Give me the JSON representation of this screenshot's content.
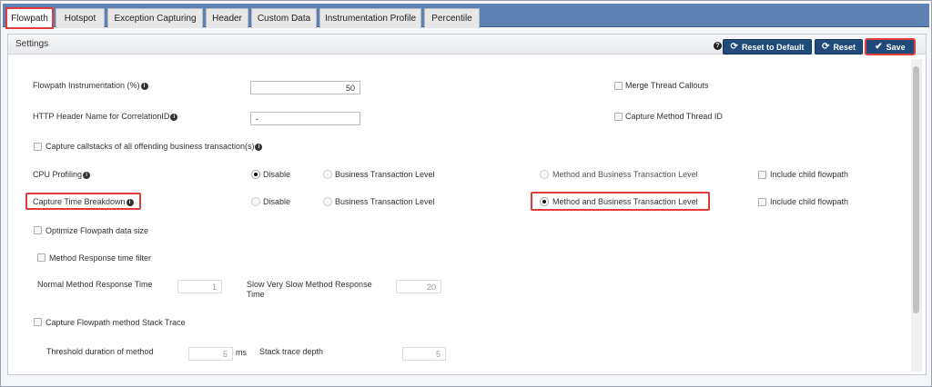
{
  "tabs": [
    "Flowpath",
    "Hotspot",
    "Exception Capturing",
    "Header",
    "Custom Data",
    "Instrumentation Profile",
    "Percentile"
  ],
  "panel": {
    "title": "Settings",
    "buttons": {
      "reset_default": "Reset to Default",
      "reset": "Reset",
      "save": "Save"
    }
  },
  "form": {
    "flowpath_instr_label": "Flowpath Instrumentation (%)",
    "flowpath_instr_value": "50",
    "http_header_label": "HTTP Header Name for CorrelationID",
    "http_header_value": "-",
    "merge_thread_label": "Merge Thread Callouts",
    "capture_thread_id_label": "Capture Method Thread ID",
    "capture_callstacks_label": "Capture callstacks of all offending business transaction(s)",
    "cpu_profiling": {
      "label": "CPU Profiling",
      "options": [
        "Disable",
        "Business Transaction Level",
        "Method and Business Transaction Level"
      ],
      "selected": "Disable",
      "child_label": "Include child flowpath"
    },
    "capture_time_breakdown": {
      "label": "Capture Time Breakdown",
      "options": [
        "Disable",
        "Business Transaction Level",
        "Method and Business Transaction Level"
      ],
      "selected": "Method and Business Transaction Level",
      "child_label": "Include child flowpath"
    },
    "optimize_label": "Optimize Flowpath data size",
    "method_resp_filter_label": "Method Response time filter",
    "normal_resp_label": "Normal Method Response Time",
    "normal_resp_value": "1",
    "slow_resp_label_1": "Slow Very Slow Method Response",
    "slow_resp_label_2": "Time",
    "slow_resp_value": "20",
    "stack_trace_label": "Capture Flowpath method Stack Trace",
    "threshold_label": "Threshold duration of method",
    "threshold_value": "5",
    "threshold_unit": "ms",
    "stack_depth_label": "Stack trace depth",
    "stack_depth_value": "5"
  },
  "icons": {
    "info": "i",
    "help": "?",
    "reset": "⟳",
    "save": "✔"
  },
  "colors": {
    "tabbar": "#5d82b3",
    "button": "#1f4a7a",
    "highlight": "#e23b3b"
  }
}
